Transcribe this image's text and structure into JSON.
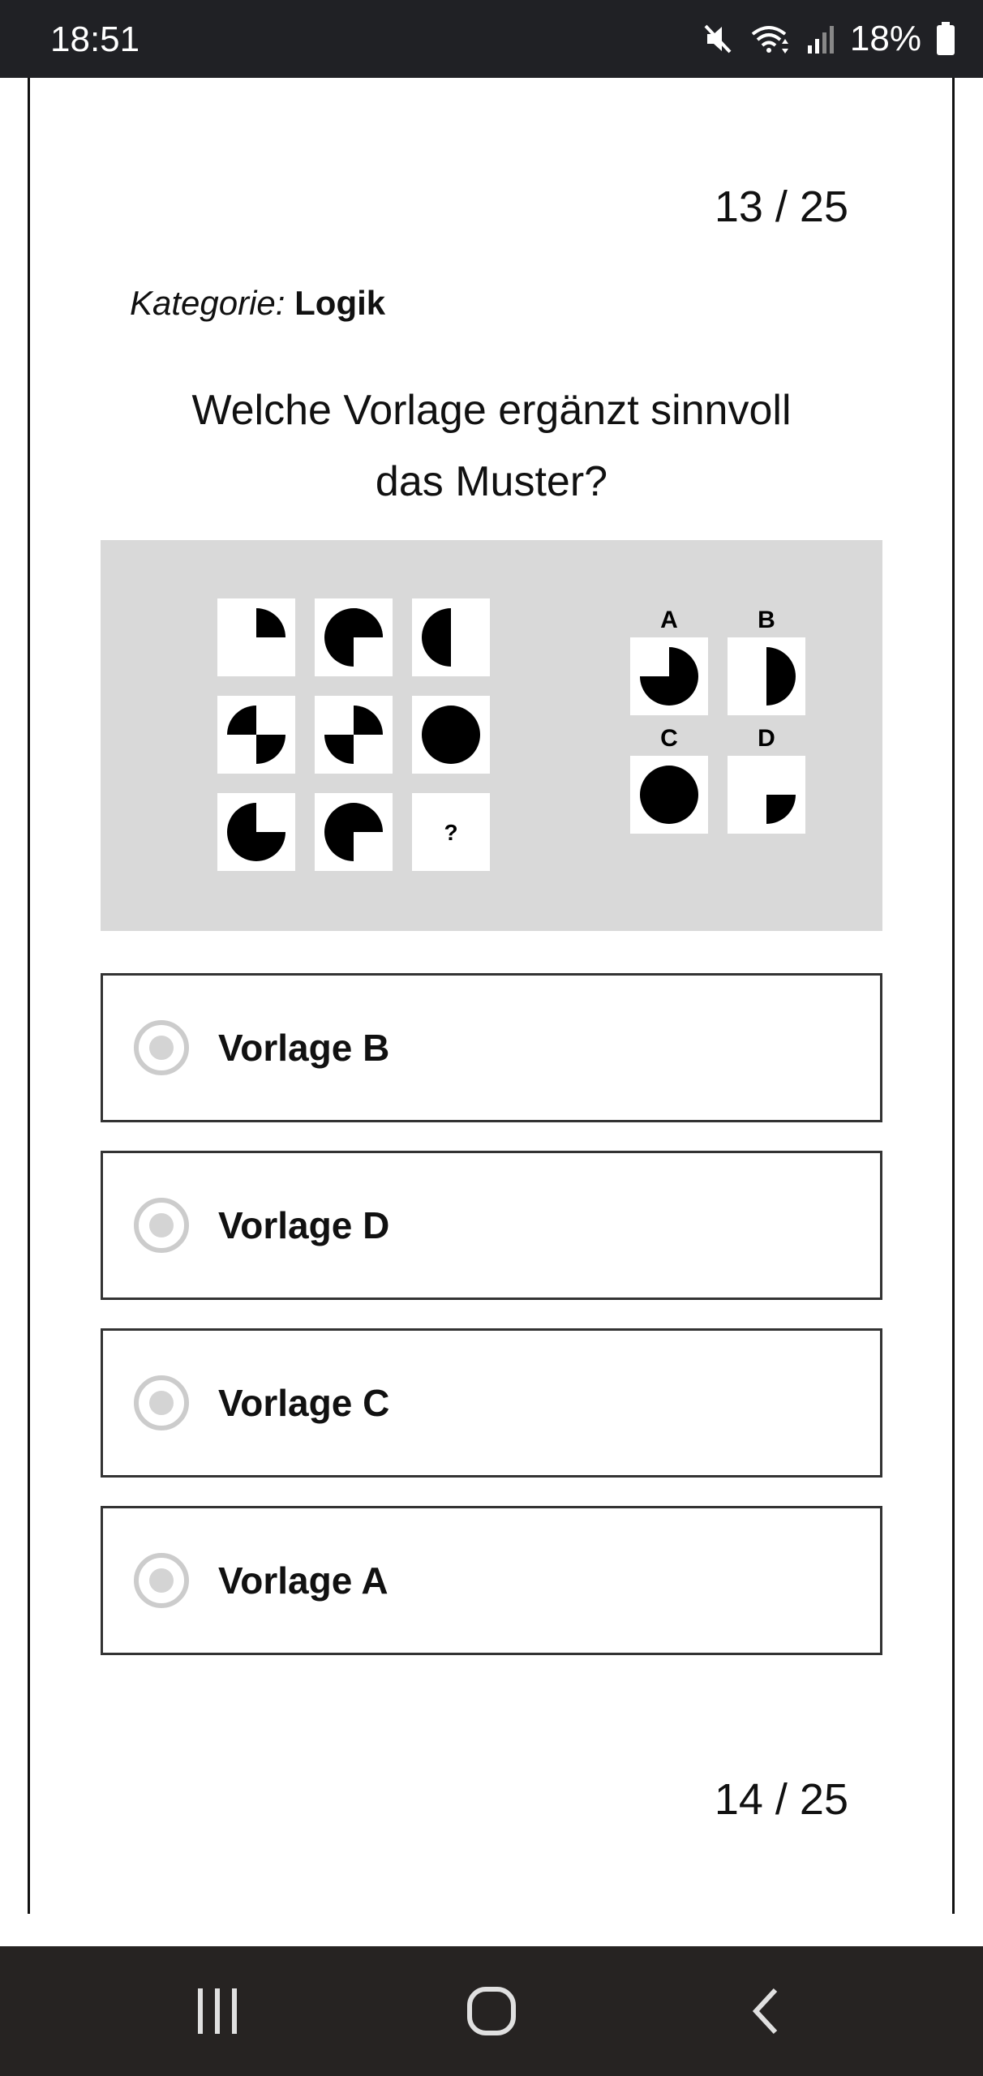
{
  "status_bar": {
    "time": "18:51",
    "battery_percent": "18%",
    "icons": [
      "mute-icon",
      "wifi-icon",
      "signal-icon",
      "battery-icon"
    ]
  },
  "quiz": {
    "counter_top": "13 / 25",
    "category_label": "Kategorie:",
    "category_value": "Logik",
    "question_line1": "Welche Vorlage ergänzt sinnvoll",
    "question_line2": "das Muster?",
    "figure": {
      "question_mark": "?",
      "choice_labels": [
        "A",
        "B",
        "C",
        "D"
      ]
    },
    "options": [
      {
        "label": "Vorlage B",
        "selected": false
      },
      {
        "label": "Vorlage D",
        "selected": false
      },
      {
        "label": "Vorlage C",
        "selected": false
      },
      {
        "label": "Vorlage A",
        "selected": false
      }
    ],
    "counter_bottom": "14 / 25"
  },
  "nav_bar": {
    "buttons": [
      "recent-apps-icon",
      "home-icon",
      "back-icon"
    ]
  }
}
